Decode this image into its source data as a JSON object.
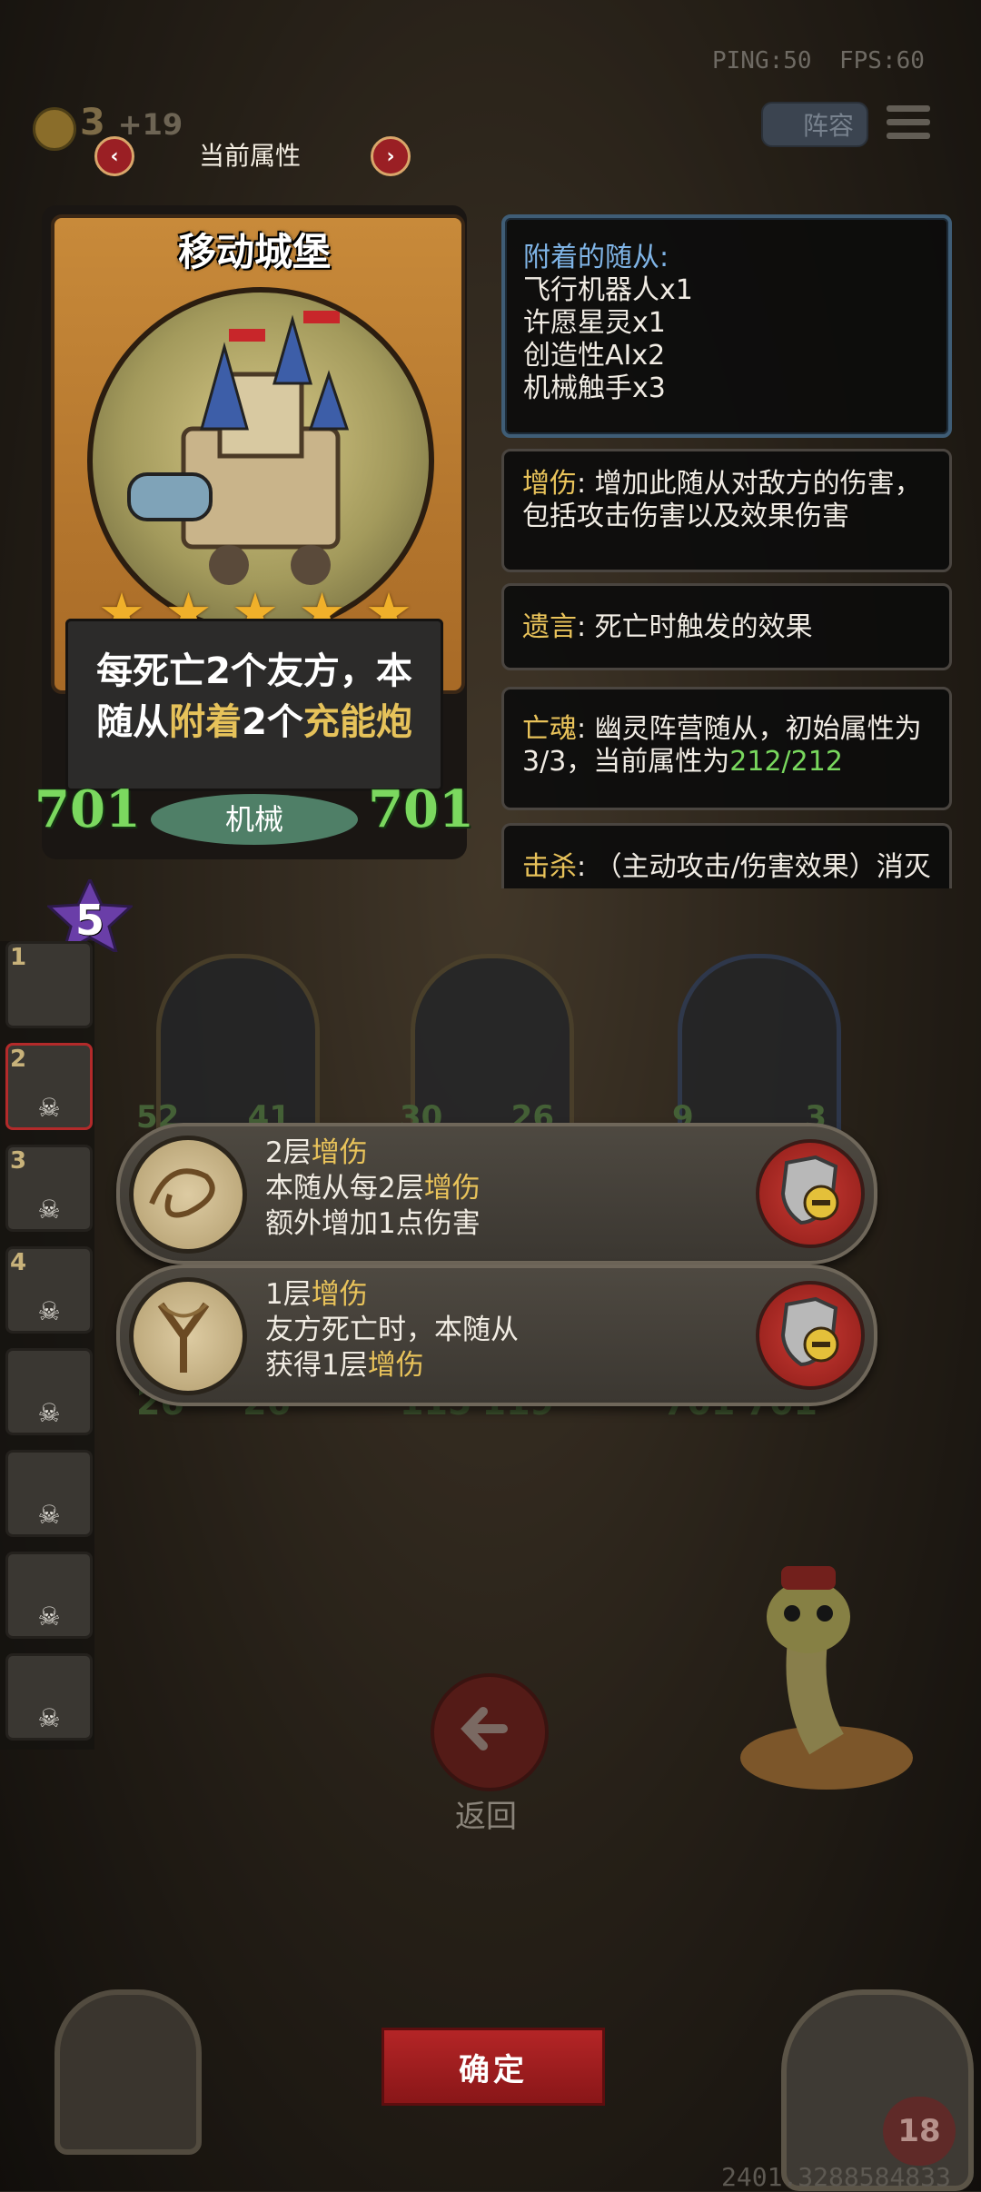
{
  "status": {
    "ping": "PING:50",
    "fps": "FPS:60"
  },
  "topbar": {
    "gold": "3",
    "gold_income": "+19",
    "lineup_label": "阵容"
  },
  "header": {
    "title": "当前属性"
  },
  "card": {
    "name": "移动城堡",
    "stars": 5,
    "desc_part1": "每死亡",
    "desc_num1": "2",
    "desc_part2": "个友方，本",
    "desc_part3": "随从",
    "desc_kw1": "附着",
    "desc_num2": "2",
    "desc_part4": "个",
    "desc_kw2": "充能炮",
    "attack": "701",
    "health": "701",
    "tribe": "机械",
    "tier": "5"
  },
  "attached": {
    "title": "附着的随从:",
    "items": [
      "飞行机器人x1",
      "许愿星灵x1",
      "创造性AIx2",
      "机械触手x3"
    ]
  },
  "keywords": [
    {
      "name": "增伤",
      "sep": ": ",
      "desc": "增加此随从对敌方的伤害，包括攻击伤害以及效果伤害"
    },
    {
      "name": "遗言",
      "sep": ": ",
      "desc": "死亡时触发的效果"
    },
    {
      "name": "亡魂",
      "sep": ": ",
      "desc_a": "幽灵阵营随从，初始属性为3/3，当前属性为",
      "desc_b": "212/212"
    },
    {
      "name": "击杀",
      "sep": ": ",
      "desc": "（主动攻击/伤害效果）消灭"
    }
  ],
  "board": {
    "row1": [
      {
        "atk": "52",
        "hp": "41"
      },
      {
        "atk": "30",
        "hp": "26"
      },
      {
        "atk": "9",
        "hp": "3"
      }
    ],
    "row2": [
      {
        "atk": "26",
        "hp": "26"
      },
      {
        "atk": "115",
        "hp": "119"
      },
      {
        "atk": "701",
        "hp": "701"
      }
    ]
  },
  "roster": [
    {
      "num": "1"
    },
    {
      "num": "2"
    },
    {
      "num": "3"
    },
    {
      "num": "4"
    },
    {
      "num": ""
    },
    {
      "num": ""
    },
    {
      "num": ""
    },
    {
      "num": ""
    }
  ],
  "effects": [
    {
      "layers": "2层",
      "kw": "增伤",
      "line2_a": "本随从每2层",
      "line2_kw": "增伤",
      "line3": "额外增加1点伤害"
    },
    {
      "layers": "1层",
      "kw": "增伤",
      "line2": "友方死亡时，本随从",
      "line3_a": "获得1层",
      "line3_kw": "增伤"
    }
  ],
  "buttons": {
    "back_label": "返回",
    "confirm_label": "确定"
  },
  "hero": {
    "hp": "18"
  },
  "footer": {
    "version": "2401.3288584833"
  },
  "colors": {
    "highlight": "#e6c25a",
    "stat_green": "#7bd85f",
    "confirm_red": "#b42526",
    "attached_border": "#3f5d76"
  }
}
